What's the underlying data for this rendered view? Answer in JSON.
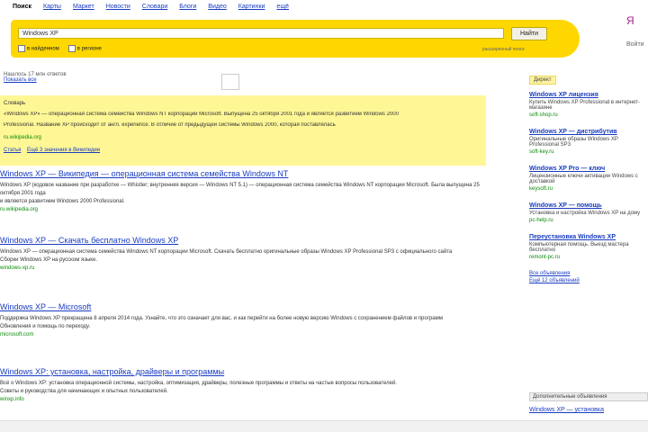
{
  "nav": {
    "active": "Поиск",
    "items": [
      "Карты",
      "Маркет",
      "Новости",
      "Словари",
      "Блоги",
      "Видео",
      "Картинки",
      "ещё"
    ]
  },
  "search": {
    "query": "Windows XP",
    "button": "Найти",
    "opt1": "в найденном",
    "opt2": "в регионе",
    "advanced": "расширенный поиск"
  },
  "right_top": {
    "logo": "Я",
    "link": "Войти"
  },
  "stats": {
    "text": "Нашлось 17 млн ответов",
    "count": "17 млн",
    "more": "Показать все"
  },
  "wizard": {
    "label": "Словарь",
    "line1": "«Windows XP» — операционная система семейства Windows NT корпорации Microsoft. Выпущена 25 октября 2001 года и является развитием Windows 2000",
    "line2": "Professional. Название XP происходит от англ. experience. В отличие от предыдущей системы Windows 2000, которая поставлялась",
    "url": "ru.wikipedia.org",
    "links": [
      "Статья",
      "Ещё 3 значения в Википедии"
    ]
  },
  "results": [
    {
      "title": "Windows XP — Википедия — операционная система семейства Windows NT",
      "snippet": "Windows XP (кодовое название при разработке — Whistler; внутренняя версия — Windows NT 5.1) — операционная система семейства Windows NT корпорации Microsoft. Была выпущена 25 октября 2001 года",
      "snippet2": "и является развитием Windows 2000 Professional.",
      "url": "ru.wikipedia.org"
    },
    {
      "title": "Windows XP — Скачать бесплатно Windows XP",
      "snippet": "Windows XP — операционная система семейства Windows NT корпорации Microsoft. Скачать бесплатно оригинальные образы Windows XP Professional SP3 с официального сайта",
      "snippet2": "Сборки Windows XP на русском языке.",
      "url": "windows-xp.ru"
    },
    {
      "title": "Windows XP — Microsoft",
      "snippet": "Поддержка Windows XP прекращена 8 апреля 2014 года. Узнайте, что это означает для вас, и как перейти на более новую версию Windows с сохранением файлов и программ",
      "snippet2": "Обновления и помощь по переходу.",
      "url": "microsoft.com"
    },
    {
      "title": "Windows XP: установка, настройка, драйверы и программы",
      "snippet": "Всё о Windows XP: установка операционной системы, настройка, оптимизация, драйверы, полезные программы и ответы на частые вопросы пользователей.",
      "snippet2": "Советы и руководства для начинающих и опытных пользователей.",
      "url": "winxp.info"
    }
  ],
  "side": {
    "header": "Директ",
    "ads": [
      {
        "title": "Windows XP лицензия",
        "snippet": "Купить Windows XP Professional в интернет-магазине",
        "url": "soft-shop.ru"
      },
      {
        "title": "Windows XP — дистрибутив",
        "snippet": "Оригинальные образы Windows XP Professional SP3",
        "url": "soft-key.ru"
      },
      {
        "title": "Windows XP Pro — ключ",
        "snippet": "Лицензионные ключи активации Windows с доставкой",
        "url": "keysoft.ru"
      },
      {
        "title": "Windows XP — помощь",
        "snippet": "Установка и настройка Windows XP на дому",
        "url": "pc-help.ru"
      },
      {
        "title": "Переустановка Windows XP",
        "snippet": "Компьютерная помощь. Выезд мастера бесплатно",
        "url": "remont-pc.ru"
      }
    ],
    "all_ads": "Все объявления",
    "extra": "Ещё 12 объявлений",
    "block2_header": "Дополнительные объявления",
    "block2_title": "Windows XP — установка"
  }
}
